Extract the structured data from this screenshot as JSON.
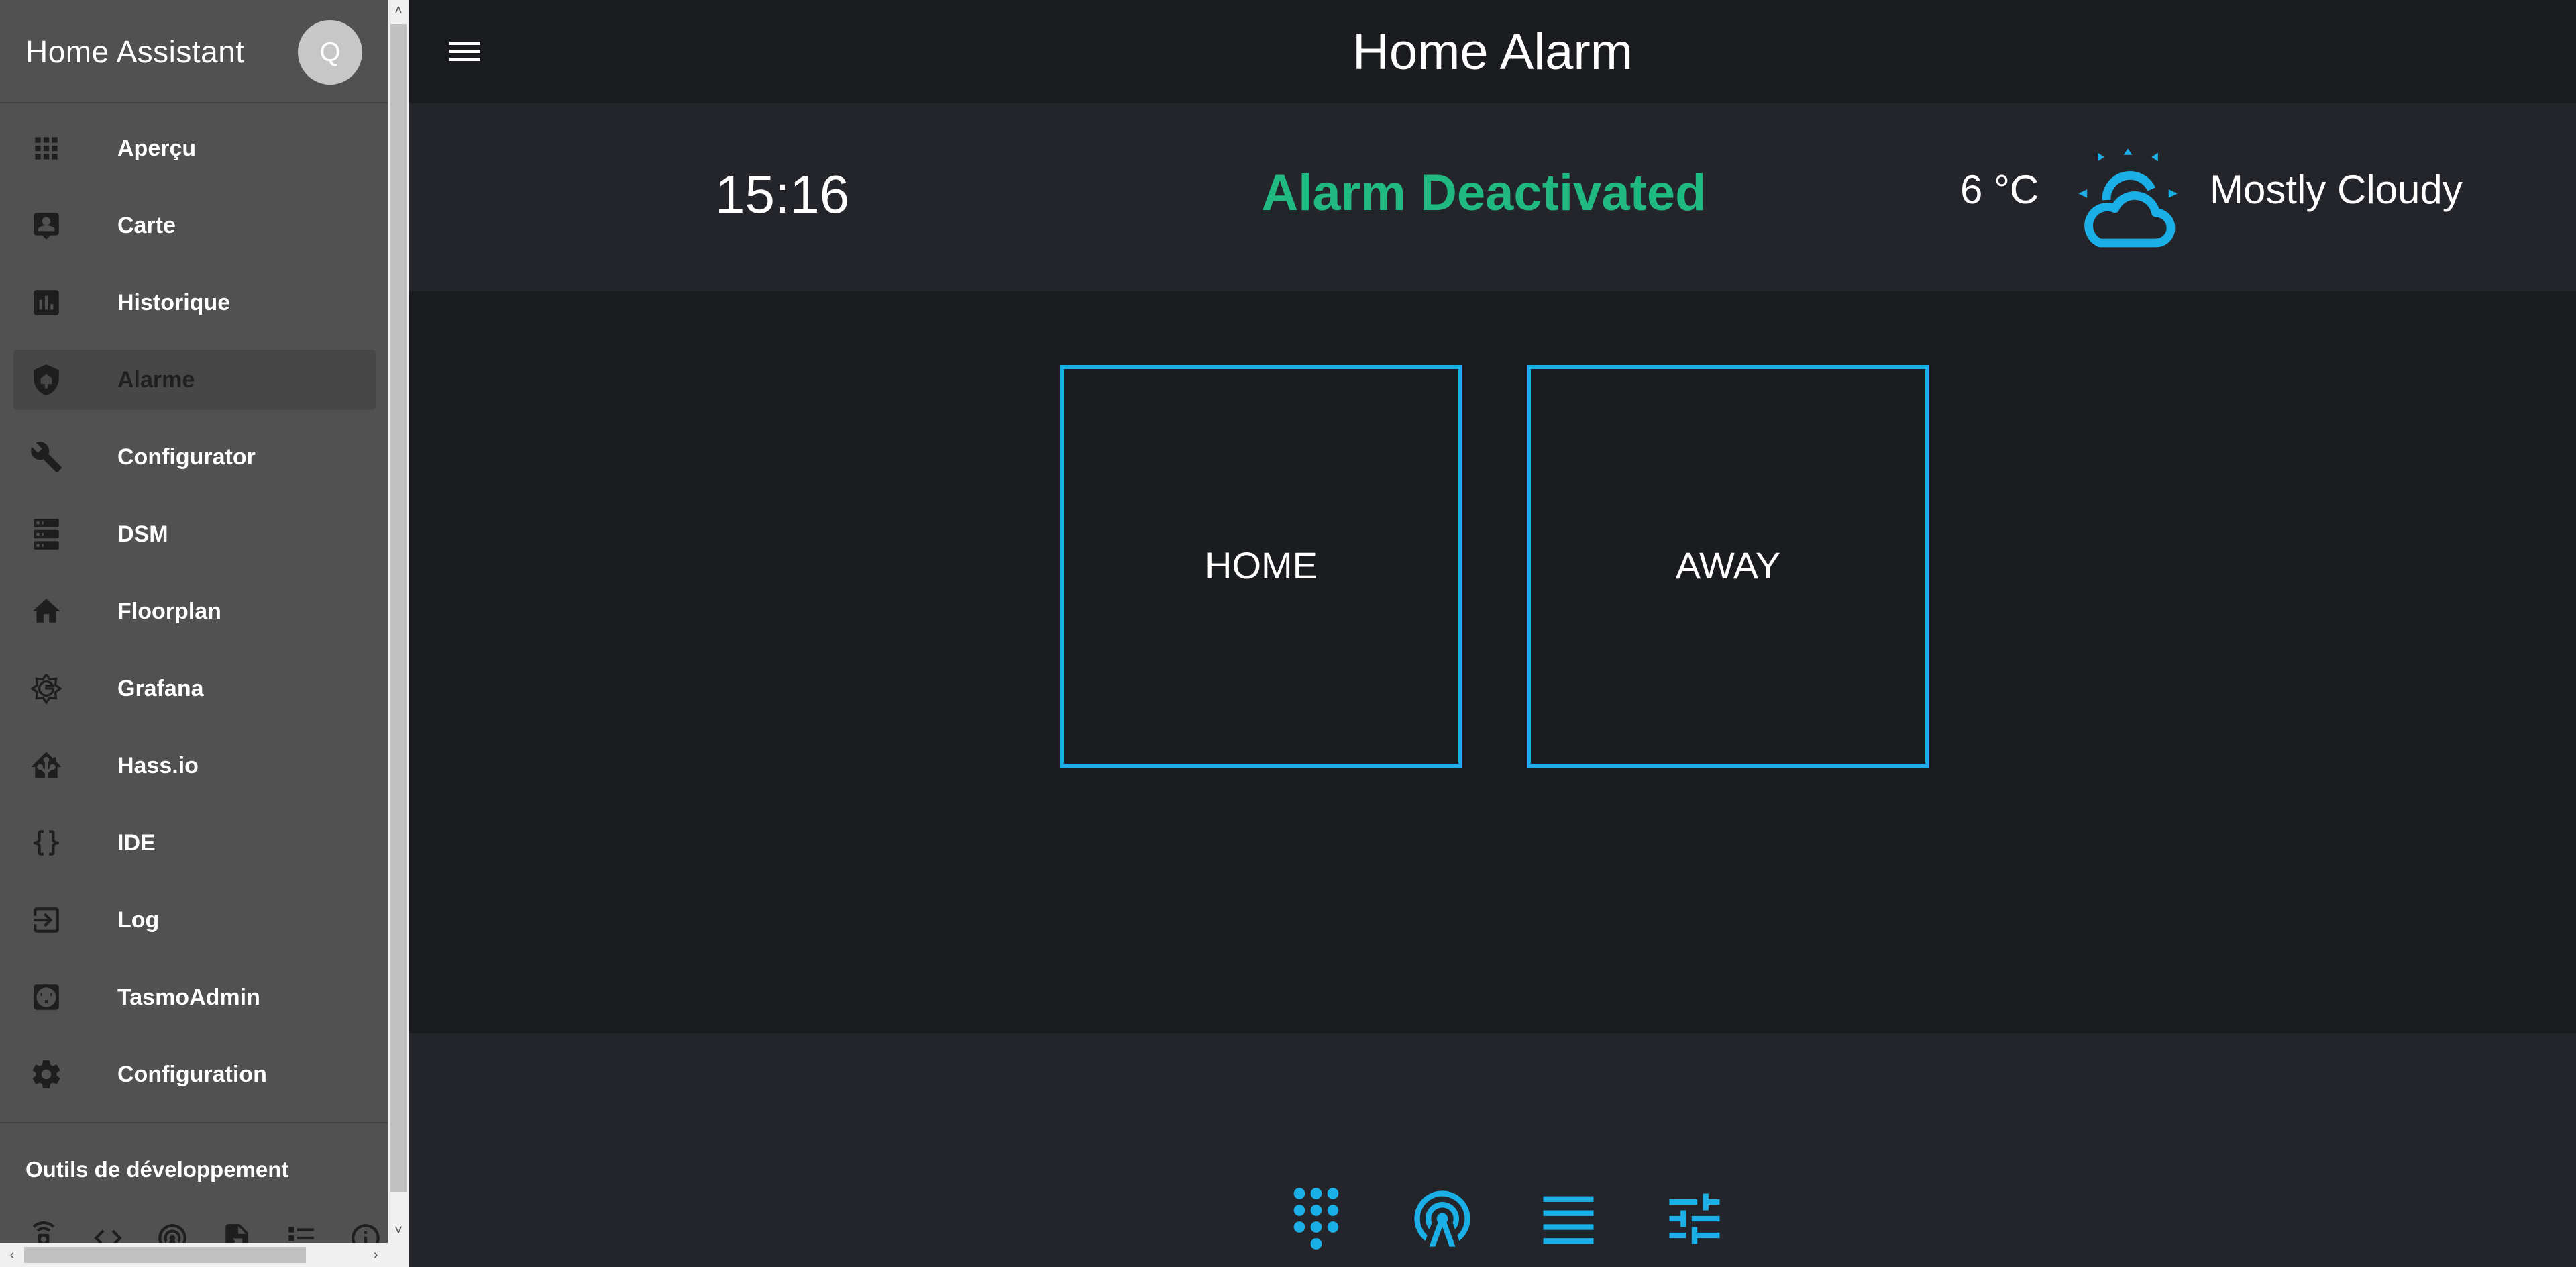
{
  "sidebar": {
    "title": "Home Assistant",
    "avatar_initial": "Q",
    "items": [
      {
        "label": "Aperçu",
        "icon": "apps-grid-icon"
      },
      {
        "label": "Carte",
        "icon": "account-box-icon"
      },
      {
        "label": "Historique",
        "icon": "chart-bar-icon"
      },
      {
        "label": "Alarme",
        "icon": "shield-home-icon",
        "active": true
      },
      {
        "label": "Configurator",
        "icon": "wrench-icon"
      },
      {
        "label": "DSM",
        "icon": "server-icon"
      },
      {
        "label": "Floorplan",
        "icon": "home-icon"
      },
      {
        "label": "Grafana",
        "icon": "grafana-icon"
      },
      {
        "label": "Hass.io",
        "icon": "home-assistant-icon"
      },
      {
        "label": "IDE",
        "icon": "code-braces-icon"
      },
      {
        "label": "Log",
        "icon": "log-in-icon"
      },
      {
        "label": "TasmoAdmin",
        "icon": "power-socket-icon"
      },
      {
        "label": "Configuration",
        "icon": "settings-icon"
      }
    ],
    "dev_tools_title": "Outils de développement",
    "dev_tools_icons": [
      "remote-icon",
      "code-tags-icon",
      "radio-tower-icon",
      "file-export-icon",
      "format-list-icon",
      "info-icon"
    ]
  },
  "header": {
    "title": "Home Alarm"
  },
  "status": {
    "time": "15:16",
    "alarm_state": "Alarm Deactivated",
    "alarm_state_color": "#1fb981",
    "temperature": "6 °C",
    "weather_condition": "Mostly Cloudy",
    "weather_icon": "partly-cloudy-day-icon"
  },
  "modes": {
    "home_label": "HOME",
    "away_label": "AWAY"
  },
  "bottom_nav": {
    "icons": [
      "dialpad-icon",
      "access-point-icon",
      "menu-lines-icon",
      "tune-icon"
    ]
  },
  "colors": {
    "accent": "#1aafe6",
    "sidebar_bg": "#515151",
    "main_bg": "#1b1c20",
    "panel_bg": "#24252a"
  }
}
